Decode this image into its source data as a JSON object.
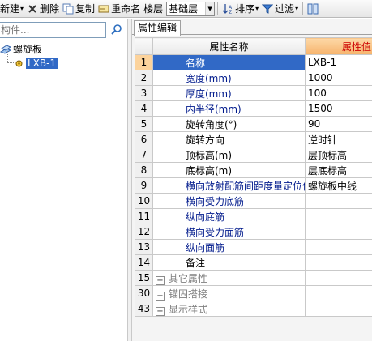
{
  "toolbar": {
    "new_label": "新建",
    "delete_label": "删除",
    "copy_label": "复制",
    "rename_label": "重命名",
    "floor_label": "楼层",
    "floor_value": "基础层",
    "sort_label": "排序",
    "filter_label": "过滤"
  },
  "left_panel": {
    "search_placeholder": "构件...",
    "tree_root": "螺旋板",
    "tree_child": "LXB-1"
  },
  "tab": {
    "label": "属性编辑"
  },
  "grid": {
    "header_name": "属性名称",
    "header_value": "属性值",
    "rows": [
      {
        "num": "1",
        "name": "名称",
        "value": "LXB-1"
      },
      {
        "num": "2",
        "name": "宽度(mm)",
        "value": "1000"
      },
      {
        "num": "3",
        "name": "厚度(mm)",
        "value": "100"
      },
      {
        "num": "4",
        "name": "内半径(mm)",
        "value": "1500"
      },
      {
        "num": "5",
        "name": "旋转角度(°)",
        "value": "90"
      },
      {
        "num": "6",
        "name": "旋转方向",
        "value": "逆时针"
      },
      {
        "num": "7",
        "name": "顶标高(m)",
        "value": "层顶标高"
      },
      {
        "num": "8",
        "name": "底标高(m)",
        "value": "层底标高"
      },
      {
        "num": "9",
        "name": "横向放射配筋间距度量定位位置",
        "value": "螺旋板中线"
      },
      {
        "num": "10",
        "name": "横向受力底筋",
        "value": ""
      },
      {
        "num": "11",
        "name": "纵向底筋",
        "value": ""
      },
      {
        "num": "12",
        "name": "横向受力面筋",
        "value": ""
      },
      {
        "num": "13",
        "name": "纵向面筋",
        "value": ""
      },
      {
        "num": "14",
        "name": "备注",
        "value": ""
      },
      {
        "num": "15",
        "name": "其它属性",
        "value": ""
      },
      {
        "num": "30",
        "name": "锚固搭接",
        "value": ""
      },
      {
        "num": "43",
        "name": "显示样式",
        "value": ""
      }
    ]
  },
  "colors": {
    "selection": "#3169c6",
    "active_num": "#fcd39c",
    "value_header": "#f6b36c",
    "blue_text": "#001a8c"
  }
}
